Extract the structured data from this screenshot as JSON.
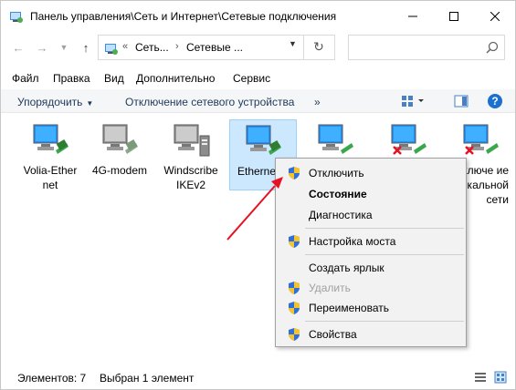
{
  "window": {
    "title": "Панель управления\\Сеть и Интернет\\Сетевые подключения",
    "icon": "network-folder-icon"
  },
  "address": {
    "prefix": "«",
    "segments": [
      "Сеть...",
      "Сетевые ..."
    ],
    "search_placeholder": ""
  },
  "menu": {
    "items": [
      "Файл",
      "Правка",
      "Вид",
      "Дополнительно",
      "Сервис"
    ]
  },
  "commands": {
    "organize": "Упорядочить",
    "disable_device": "Отключение сетевого устройства",
    "more": "»"
  },
  "adapters": [
    {
      "label": "Volia-Ether net",
      "state": "connected"
    },
    {
      "label": "4G-modem",
      "state": "disconnected"
    },
    {
      "label": "Windscribe IKEv2",
      "state": "vpn"
    },
    {
      "label": "Etherne",
      "state": "selected"
    },
    {
      "label": "",
      "state": "connected"
    },
    {
      "label": "",
      "state": "error"
    },
    {
      "label": "дключе ие по кальной сети",
      "state": "error"
    }
  ],
  "context_menu": {
    "items": [
      {
        "label": "Отключить",
        "shield": true,
        "style": "normal"
      },
      {
        "label": "Состояние",
        "shield": false,
        "style": "bold"
      },
      {
        "label": "Диагностика",
        "shield": false,
        "style": "normal"
      },
      {
        "label": "Настройка моста",
        "shield": true,
        "style": "normal"
      },
      {
        "label": "Создать ярлык",
        "shield": false,
        "style": "normal"
      },
      {
        "label": "Удалить",
        "shield": true,
        "style": "disabled"
      },
      {
        "label": "Переименовать",
        "shield": true,
        "style": "normal"
      },
      {
        "label": "Свойства",
        "shield": true,
        "style": "normal"
      }
    ]
  },
  "status": {
    "count": "Элементов: 7",
    "selected": "Выбран 1 элемент"
  },
  "colors": {
    "accent": "#0078d7",
    "selection": "#cce8ff",
    "arrow": "#e81123",
    "command_text": "#1e395b"
  }
}
